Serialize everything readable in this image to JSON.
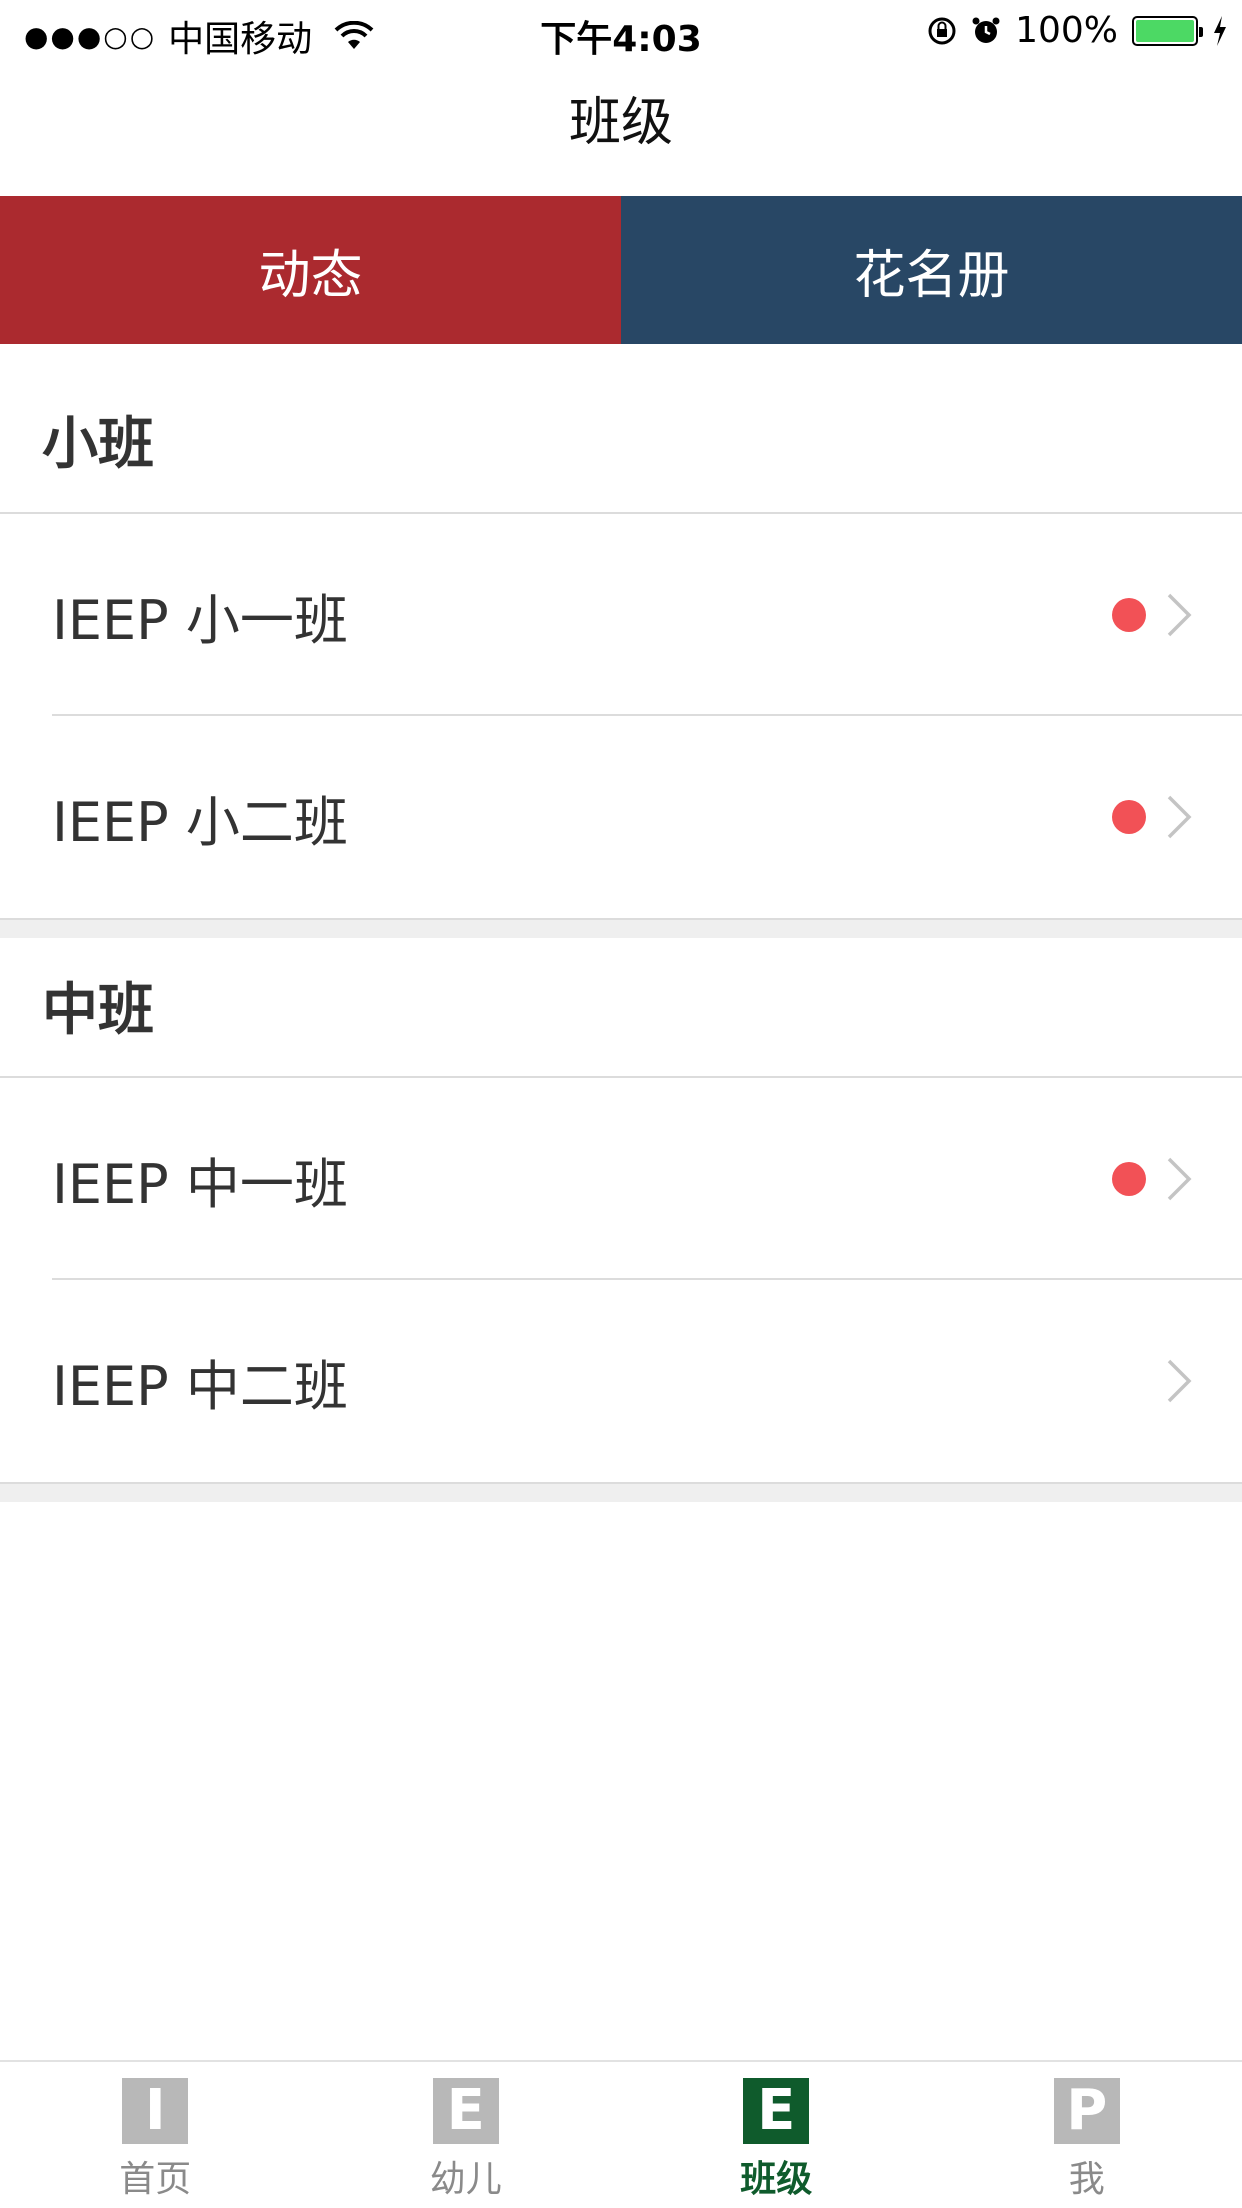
{
  "status_bar": {
    "signal": "●●●○○",
    "carrier": "中国移动",
    "time": "下午4:03",
    "battery": "100%"
  },
  "nav": {
    "title": "班级"
  },
  "tabs": [
    {
      "label": "动态",
      "active": true
    },
    {
      "label": "花名册",
      "active": false
    }
  ],
  "sections": [
    {
      "title": "小班",
      "rows": [
        {
          "label": "IEEP 小一班",
          "unread": true
        },
        {
          "label": "IEEP 小二班",
          "unread": true
        }
      ]
    },
    {
      "title": "中班",
      "rows": [
        {
          "label": "IEEP 中一班",
          "unread": true
        },
        {
          "label": "IEEP 中二班",
          "unread": false
        }
      ]
    }
  ],
  "tabbar": [
    {
      "icon": "I",
      "label": "首页",
      "active": false
    },
    {
      "icon": "E",
      "label": "幼儿",
      "active": false
    },
    {
      "icon": "E",
      "label": "班级",
      "active": true
    },
    {
      "icon": "P",
      "label": "我",
      "active": false
    }
  ],
  "colors": {
    "tab_active": "#ab2a2f",
    "tab_inactive": "#284765",
    "unread_dot": "#f25156",
    "tabbar_active": "#0f5b2c",
    "battery": "#4cd964"
  }
}
